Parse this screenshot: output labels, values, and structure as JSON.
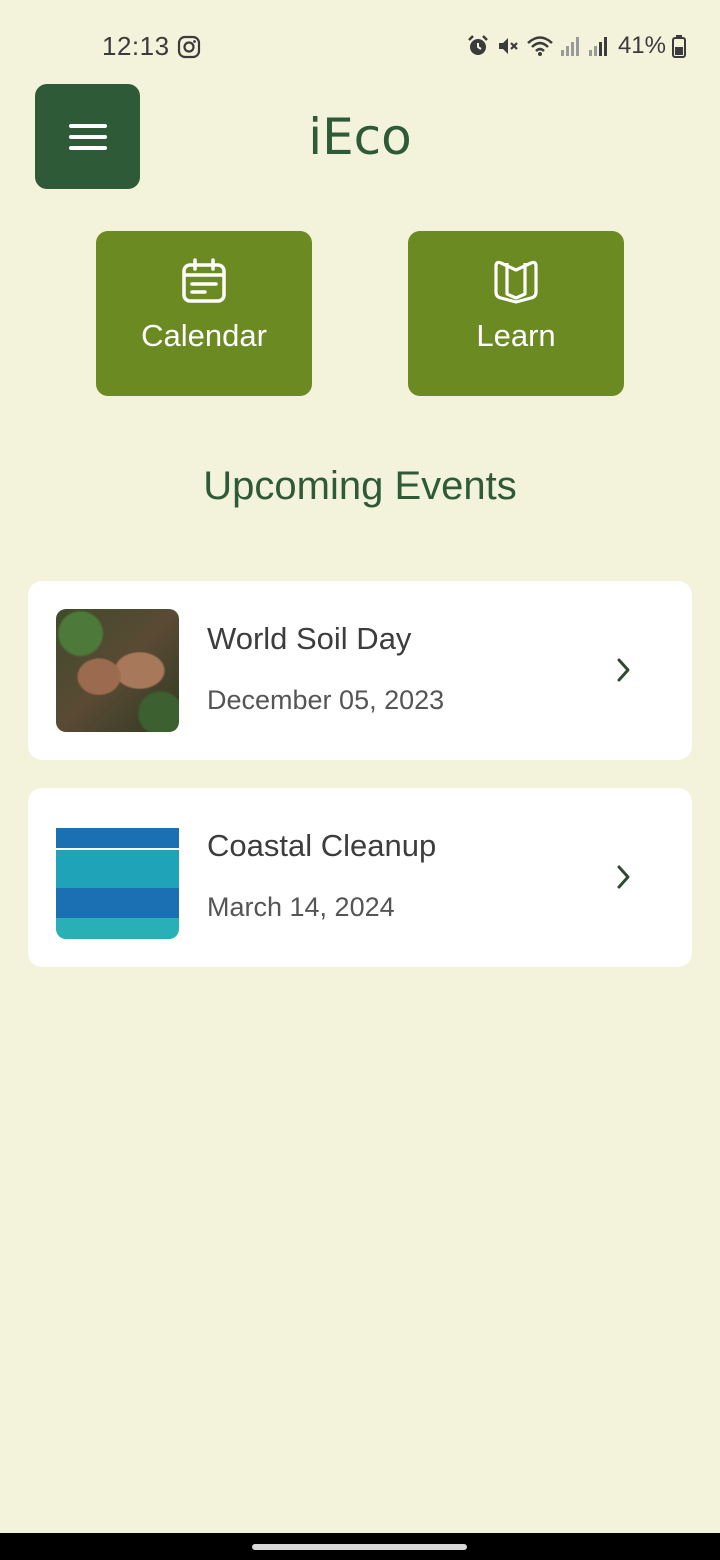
{
  "status_bar": {
    "time": "12:13",
    "battery": "41%",
    "icons": [
      "instagram-icon",
      "alarm-icon",
      "mute-icon",
      "wifi-icon",
      "signal-icon",
      "signal-icon",
      "battery-icon"
    ]
  },
  "header": {
    "title": "iEco",
    "menu_icon": "hamburger-menu-icon"
  },
  "quick_actions": [
    {
      "label": "Calendar",
      "icon": "calendar-icon"
    },
    {
      "label": "Learn",
      "icon": "book-icon"
    }
  ],
  "events_section": {
    "title": "Upcoming Events",
    "events": [
      {
        "name": "World Soil Day",
        "date": "December 05, 2023",
        "image": "hands-in-soil-photo"
      },
      {
        "name": "Coastal Cleanup",
        "date": "March 14, 2024",
        "image": "coastal-cleanup-logo"
      }
    ]
  },
  "colors": {
    "background": "#f3f3dc",
    "dark_green": "#2f5a37",
    "olive_green": "#6b8a22",
    "card": "#ffffff"
  }
}
